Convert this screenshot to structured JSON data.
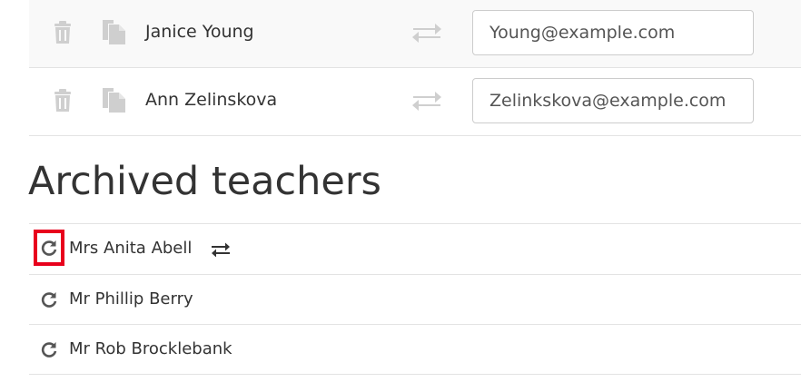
{
  "active_teachers": [
    {
      "name": "Janice Young",
      "email": "Young@example.com"
    },
    {
      "name": "Ann Zelinskova",
      "email": "Zelinkskova@example.com"
    }
  ],
  "archived": {
    "heading": "Archived teachers",
    "teachers": [
      {
        "name": "Mrs Anita Abell"
      },
      {
        "name": "Mr Phillip Berry"
      },
      {
        "name": "Mr Rob Brocklebank"
      }
    ]
  },
  "icons": {
    "delete": "trash-icon",
    "copy": "copy-icon",
    "transfer": "swap-arrows-icon",
    "restore": "refresh-icon"
  },
  "colors": {
    "muted_icon": "#cccccc",
    "dark_icon": "#333333",
    "highlight": "#e8001c"
  }
}
